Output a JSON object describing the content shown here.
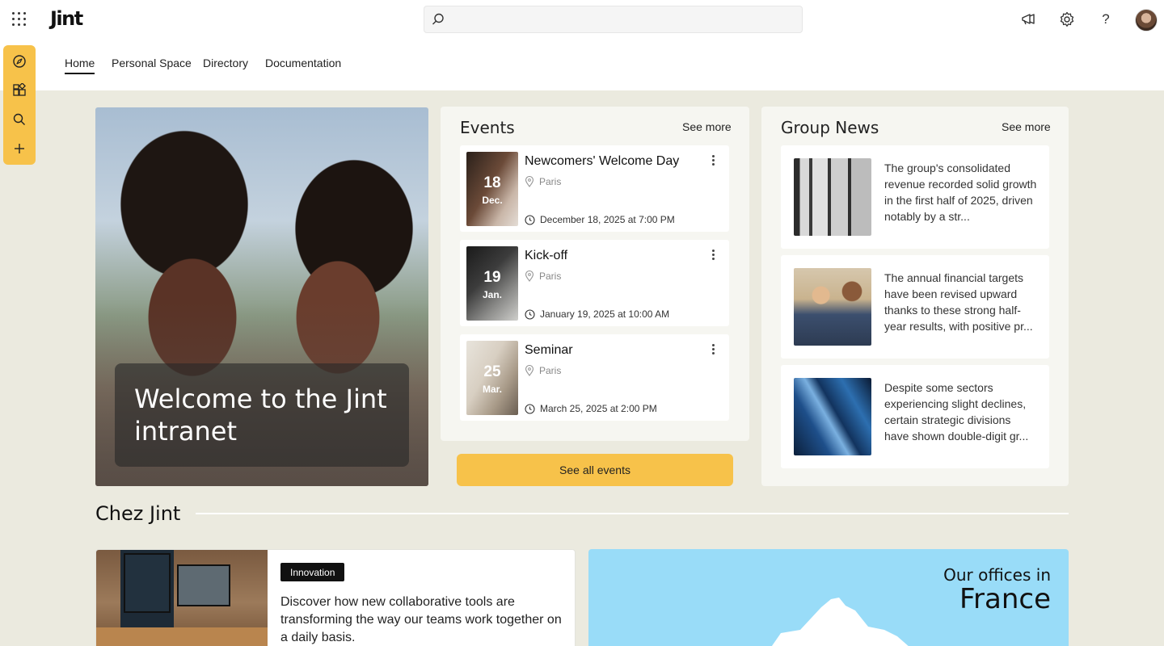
{
  "app": {
    "logo": "Jint",
    "search_placeholder": ""
  },
  "nav": {
    "items": [
      "Home",
      "Personal Space",
      "Directory",
      "Documentation"
    ],
    "active": "Home"
  },
  "hero": {
    "caption": "Welcome to the Jint intranet"
  },
  "events": {
    "title": "Events",
    "see_more": "See more",
    "items": [
      {
        "day": "18",
        "month": "Dec.",
        "title": "Newcomers' Welcome Day",
        "location": "Paris",
        "when": "December 18, 2025 at 7:00 PM"
      },
      {
        "day": "19",
        "month": "Jan.",
        "title": "Kick-off",
        "location": "Paris",
        "when": "January 19, 2025 at 10:00 AM"
      },
      {
        "day": "25",
        "month": "Mar.",
        "title": "Seminar",
        "location": "Paris",
        "when": "March 25, 2025 at 2:00 PM"
      }
    ],
    "cta": "See all events"
  },
  "news": {
    "title": "Group News",
    "see_more": "See more",
    "items": [
      {
        "text": "The group's consolidated revenue recorded solid growth in the first half of 2025, driven notably by a str..."
      },
      {
        "text": "The annual financial targets have been revised upward thanks to these strong half-year results, with positive pr..."
      },
      {
        "text": "Despite some sectors experiencing slight declines, certain strategic divisions have shown double-digit gr..."
      }
    ]
  },
  "chez_jint": {
    "title": "Chez Jint",
    "article": {
      "tag": "Innovation",
      "text": "Discover how new collaborative tools are transforming the way our teams work together on a daily basis."
    },
    "offices": {
      "subtitle": "Our offices in",
      "title": "France"
    }
  },
  "colors": {
    "accent": "#f7c24a",
    "background": "#ebeadf",
    "offices_bg": "#99dcf8"
  },
  "icons": {
    "top": [
      "apps-icon",
      "search-icon",
      "megaphone-icon",
      "gear-icon",
      "help-icon",
      "avatar"
    ],
    "rail": [
      "compass-icon",
      "apps-grid-icon",
      "search-icon",
      "plus-icon"
    ]
  }
}
